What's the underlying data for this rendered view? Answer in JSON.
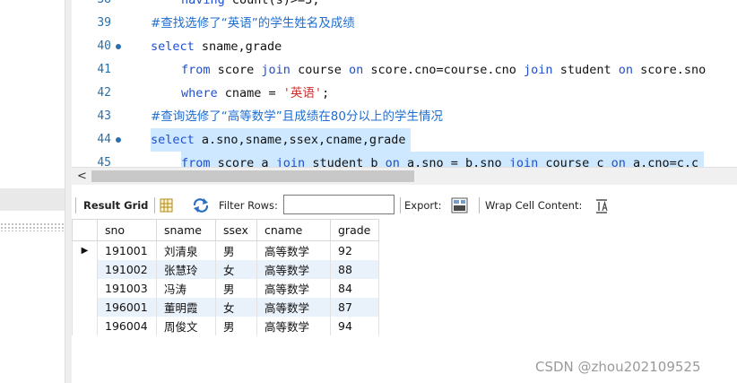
{
  "editor": {
    "lines": [
      {
        "num": "38",
        "bp": false,
        "hl": false,
        "indent": 1,
        "kind": "code",
        "text": "having count(s)>=3;"
      },
      {
        "num": "39",
        "bp": false,
        "hl": false,
        "indent": 0,
        "kind": "comment",
        "text": "#查找选修了“英语”的学生姓名及成绩"
      },
      {
        "num": "40",
        "bp": true,
        "hl": false,
        "indent": 0,
        "kind": "code",
        "text": "select sname,grade"
      },
      {
        "num": "41",
        "bp": false,
        "hl": false,
        "indent": 1,
        "kind": "code",
        "text": "from score join course on score.cno=course.cno join student on score.sno"
      },
      {
        "num": "42",
        "bp": false,
        "hl": false,
        "indent": 1,
        "kind": "code",
        "text": "where cname = '英语';"
      },
      {
        "num": "43",
        "bp": false,
        "hl": false,
        "indent": 0,
        "kind": "comment",
        "text": "#查询选修了“高等数学”且成绩在80分以上的学生情况"
      },
      {
        "num": "44",
        "bp": true,
        "hl": true,
        "indent": 0,
        "kind": "code",
        "text": "select a.sno,sname,ssex,cname,grade"
      },
      {
        "num": "45",
        "bp": false,
        "hl": true,
        "indent": 1,
        "kind": "code",
        "text": "from score a join student b on a.sno = b.sno join course c on a.cno=c.c"
      }
    ],
    "keywords": [
      "select",
      "from",
      "join",
      "on",
      "where",
      "having"
    ]
  },
  "scrollbar": {
    "left_arrow": "<"
  },
  "toolbar": {
    "result_grid_label": "Result Grid",
    "filter_rows_label": "Filter Rows:",
    "filter_value": "",
    "export_label": "Export:",
    "wrap_label": "Wrap Cell Content:"
  },
  "grid": {
    "columns": [
      "sno",
      "sname",
      "ssex",
      "cname",
      "grade"
    ],
    "rows": [
      [
        "191001",
        "刘清泉",
        "男",
        "高等数学",
        "92"
      ],
      [
        "191002",
        "张慧玲",
        "女",
        "高等数学",
        "88"
      ],
      [
        "191003",
        "冯涛",
        "男",
        "高等数学",
        "84"
      ],
      [
        "196001",
        "董明霞",
        "女",
        "高等数学",
        "87"
      ],
      [
        "196004",
        "周俊文",
        "男",
        "高等数学",
        "94"
      ]
    ],
    "current_row_marker": "▶"
  },
  "watermark": "CSDN @zhou202109525",
  "colors": {
    "keyword": "#1f4fd0",
    "comment": "#1f6ed0",
    "string": "#d12f2f",
    "selection": "#cde8ff",
    "row_alt": "#e9f1fb"
  }
}
